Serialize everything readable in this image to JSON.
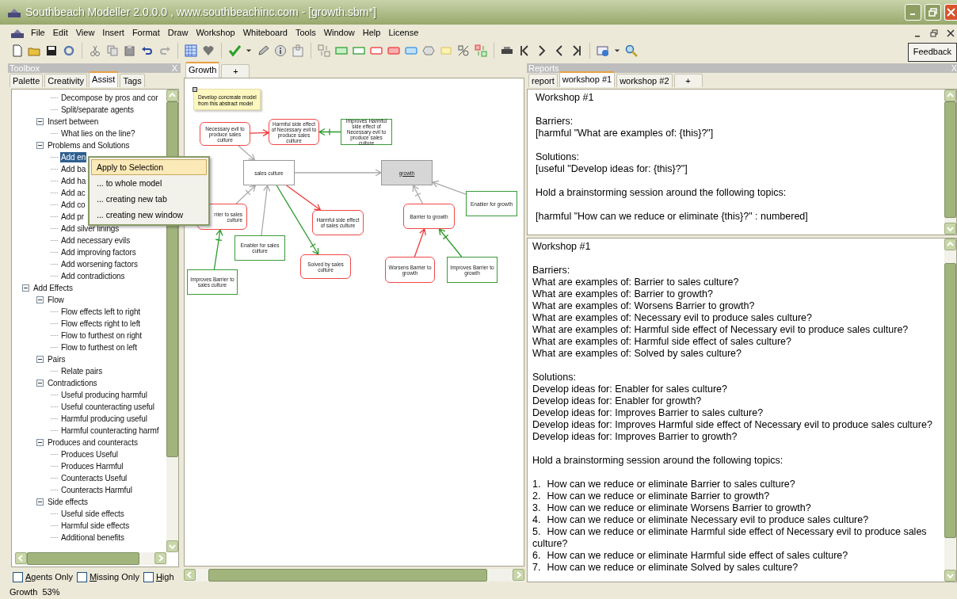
{
  "window": {
    "title": "Southbeach Modeller 2.0.0.0 , www.southbeachinc.com - [growth.sbm*]"
  },
  "menu": [
    "File",
    "Edit",
    "View",
    "Insert",
    "Format",
    "Draw",
    "Workshop",
    "Whiteboard",
    "Tools",
    "Window",
    "Help",
    "License"
  ],
  "feedback_button": "Feedback",
  "toolbox": {
    "title": "Toolbox",
    "close": "X",
    "tabs": [
      {
        "label": "Palette",
        "selected": false
      },
      {
        "label": "Creativity",
        "selected": false
      },
      {
        "label": "Assist",
        "selected": true
      },
      {
        "label": "Tags",
        "selected": false
      }
    ],
    "tree": [
      {
        "children": [
          {
            "children": [
              {
                "label": "Decompose by pros and cor",
                "selected": false
              },
              {
                "label": "Split/separate agents",
                "selected": false
              }
            ]
          },
          {
            "label": "Insert between",
            "expanded": true,
            "selected": false,
            "children": [
              {
                "label": "What lies on the line?",
                "selected": false
              }
            ]
          },
          {
            "label": "Problems and Solutions",
            "expanded": true,
            "selected": false,
            "children": [
              {
                "label": "Add en",
                "selected": true
              },
              {
                "label": "Add ba",
                "selected": false
              },
              {
                "label": "Add ha",
                "selected": false
              },
              {
                "label": "Add ac",
                "selected": false
              },
              {
                "label": "Add co",
                "selected": false
              },
              {
                "label": "Add pr",
                "selected": false
              },
              {
                "label": "Add silver linings",
                "selected": false
              },
              {
                "label": "Add necessary evils",
                "selected": false
              },
              {
                "label": "Add improving factors",
                "selected": false
              },
              {
                "label": "Add worsening factors",
                "selected": false
              },
              {
                "label": "Add contradictions",
                "selected": false
              }
            ]
          }
        ]
      },
      {
        "label": "Add Effects",
        "expanded": true,
        "selected": false,
        "children": [
          {
            "label": "Flow",
            "expanded": true,
            "selected": false,
            "children": [
              {
                "label": "Flow effects left to right",
                "selected": false
              },
              {
                "label": "Flow effects right to left",
                "selected": false
              },
              {
                "label": "Flow to furthest on right",
                "selected": false
              },
              {
                "label": "Flow to furthest on left",
                "selected": false
              }
            ]
          },
          {
            "label": "Pairs",
            "expanded": true,
            "selected": false,
            "children": [
              {
                "label": "Relate pairs",
                "selected": false
              }
            ]
          },
          {
            "label": "Contradictions",
            "expanded": true,
            "selected": false,
            "children": [
              {
                "label": "Useful producing harmful",
                "selected": false
              },
              {
                "label": "Useful counteracting useful",
                "selected": false
              },
              {
                "label": "Harmful producing useful",
                "selected": false
              },
              {
                "label": "Harmful counteracting harmf",
                "selected": false
              }
            ]
          },
          {
            "label": "Produces and counteracts",
            "expanded": true,
            "selected": false,
            "children": [
              {
                "label": "Produces Useful",
                "selected": false
              },
              {
                "label": "Produces Harmful",
                "selected": false
              },
              {
                "label": "Counteracts Useful",
                "selected": false
              },
              {
                "label": "Counteracts Harmful",
                "selected": false
              }
            ]
          },
          {
            "label": "Side effects",
            "expanded": true,
            "selected": false,
            "children": [
              {
                "label": "Useful side effects",
                "selected": false
              },
              {
                "label": "Harmful side effects",
                "selected": false
              },
              {
                "label": "Additional benefits",
                "selected": false
              }
            ]
          }
        ]
      }
    ],
    "filters": [
      {
        "label": "Agents Only",
        "checked": false
      },
      {
        "label": "Missing Only",
        "checked": false
      },
      {
        "label": "High",
        "checked": false
      }
    ]
  },
  "context_menu": [
    {
      "label": "Apply to Selection",
      "selected": true
    },
    {
      "label": "... to whole model",
      "selected": false
    },
    {
      "label": "... creating new tab",
      "selected": false
    },
    {
      "label": "... creating new window",
      "selected": false
    }
  ],
  "diagram": {
    "tabs": [
      {
        "label": "Growth",
        "selected": true
      },
      {
        "label": "+",
        "selected": false
      }
    ],
    "note": "Develop concreate model from this abstract model",
    "nodes": [
      {
        "label": "Necessary evil to produce sales culture",
        "kind": "harmful"
      },
      {
        "label": "Harmful side effect of Necessary evil to produce sales culture",
        "kind": "harmful"
      },
      {
        "label": "Improves Harmful side effect of Necessary evil to produce sales culture",
        "kind": "useful"
      },
      {
        "label": "sales culture",
        "kind": "plain"
      },
      {
        "label": "growth",
        "kind": "goal"
      },
      {
        "label": "rrier to sales culture",
        "kind": "harmful"
      },
      {
        "label": "Enabler for sales culture",
        "kind": "useful"
      },
      {
        "label": "Harmful side effect of sales culture",
        "kind": "harmful"
      },
      {
        "label": "Solved by sales culture",
        "kind": "harmful"
      },
      {
        "label": "Barrier to growth",
        "kind": "harmful"
      },
      {
        "label": "Enabler for growth",
        "kind": "useful"
      },
      {
        "label": "Worsens Barrier to growth",
        "kind": "harmful"
      },
      {
        "label": "Improves Barrier to growth",
        "kind": "useful"
      },
      {
        "label": "Improves Barrier to sales culture",
        "kind": "useful"
      }
    ],
    "connectors": [
      {
        "kind": "harmful",
        "blocked": false
      },
      {
        "kind": "neutral",
        "blocked": false
      },
      {
        "kind": "useful",
        "blocked": true
      },
      {
        "kind": "neutral",
        "blocked": false
      },
      {
        "kind": "harmful",
        "blocked": false
      },
      {
        "kind": "useful",
        "blocked": true
      },
      {
        "kind": "neutral",
        "blocked": true
      },
      {
        "kind": "neutral",
        "blocked": false
      },
      {
        "kind": "neutral",
        "blocked": true
      },
      {
        "kind": "neutral",
        "blocked": false
      },
      {
        "kind": "harmful",
        "blocked": false
      },
      {
        "kind": "useful",
        "blocked": true
      },
      {
        "kind": "useful",
        "blocked": true
      }
    ]
  },
  "reports": {
    "title": "Reports",
    "close": "X",
    "tabs": [
      {
        "label": "report",
        "selected": false
      },
      {
        "label": "workshop #1",
        "selected": true
      },
      {
        "label": "workshop #2",
        "selected": false
      },
      {
        "label": "+",
        "selected": false
      }
    ],
    "editor": {
      "paragraphs": [
        [
          "Workshop #1"
        ],
        [
          "Barriers:",
          "[harmful \"What are examples of: {this}?\"]"
        ],
        [
          "Solutions:",
          "[useful \"Develop ideas for: {this}?\"]"
        ],
        [
          "Hold a brainstorming session around the following topics:"
        ],
        [
          "[harmful \"How can we reduce or eliminate {this}?\" : numbered]"
        ]
      ]
    },
    "output": {
      "title": "Workshop #1",
      "sections": [
        {
          "heading": "Barriers:",
          "lines": [
            "What are examples of: Barrier to sales culture?",
            "What are examples of: Barrier to growth?",
            "What are examples of: Worsens Barrier to growth?",
            "What are examples of: Necessary evil to produce sales culture?",
            "What are examples of: Harmful side effect of Necessary evil to produce sales culture?",
            "What are examples of: Harmful side effect of sales culture?",
            "What are examples of: Solved by sales culture?"
          ]
        },
        {
          "heading": "Solutions:",
          "lines": [
            "Develop ideas for: Enabler for sales culture?",
            "Develop ideas for: Enabler for growth?",
            "Develop ideas for: Improves Barrier to sales culture?",
            "Develop ideas for: Improves Harmful side effect of Necessary evil to produce sales culture?",
            "Develop ideas for: Improves Barrier to growth?"
          ]
        }
      ],
      "intro": "Hold a brainstorming session around the following topics:",
      "topics": [
        {
          "number": "1.",
          "text": "How can we reduce or eliminate Barrier to sales culture?"
        },
        {
          "number": "2.",
          "text": "How can we reduce or eliminate Barrier to growth?"
        },
        {
          "number": "3.",
          "text": "How can we reduce or eliminate Worsens Barrier to growth?"
        },
        {
          "number": "4.",
          "text": "How can we reduce or eliminate Necessary evil to produce sales culture?"
        },
        {
          "number": "5.",
          "text": "How can we reduce or eliminate Harmful side effect of Necessary evil to produce sales culture?"
        },
        {
          "number": "6.",
          "text": "How can we reduce or eliminate Harmful side effect of sales culture?"
        },
        {
          "number": "7.",
          "text": "How can we reduce or eliminate Solved by sales culture?"
        }
      ]
    }
  },
  "status_bar": {
    "name": "Growth",
    "zoom": "53%"
  }
}
